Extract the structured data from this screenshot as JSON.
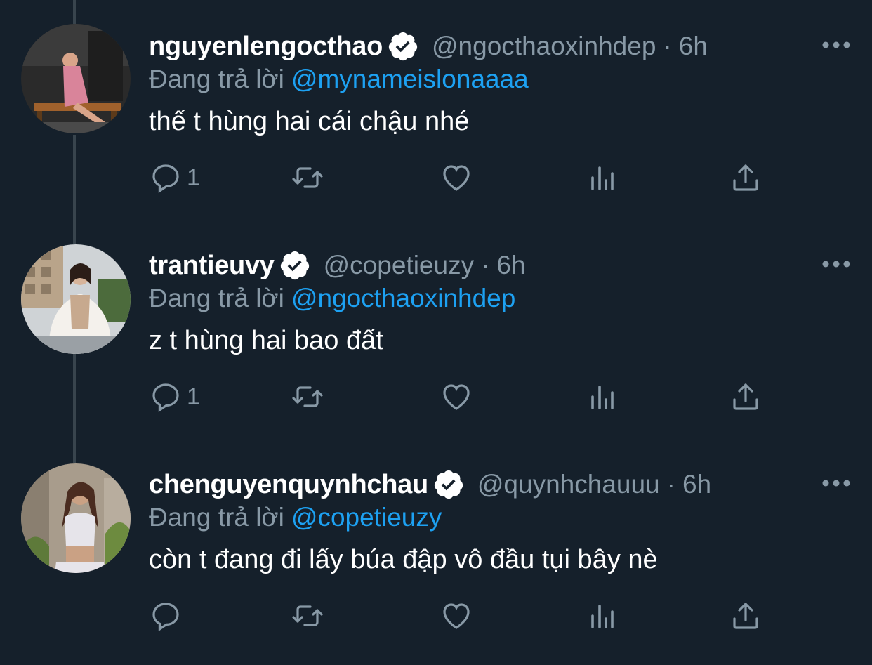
{
  "thread": {
    "tweets": [
      {
        "display_name": "nguyenlengocthao",
        "handle": "@ngocthaoxinhdep",
        "separator": "·",
        "time": "6h",
        "reply_prefix": "Đang trả lời",
        "reply_to": "@mynameislonaaaa",
        "text": "thế t hùng hai cái chậu nhé",
        "reply_count": "1",
        "verified": true
      },
      {
        "display_name": "trantieuvy",
        "handle": "@copetieuzy",
        "separator": "·",
        "time": "6h",
        "reply_prefix": "Đang trả lời",
        "reply_to": "@ngocthaoxinhdep",
        "text": "z t hùng hai bao đất",
        "reply_count": "1",
        "verified": true
      },
      {
        "display_name": "chenguyenquynhchau",
        "handle": "@quynhchauuu",
        "separator": "·",
        "time": "6h",
        "reply_prefix": "Đang trả lời",
        "reply_to": "@copetieuzy",
        "text": "còn t đang đi lấy búa đập vô đầu tụi bây nè",
        "reply_count": "",
        "verified": true
      }
    ]
  },
  "icons": {
    "verified": "verified-badge-icon",
    "more": "more-options-icon",
    "reply": "reply-icon",
    "retweet": "retweet-icon",
    "like": "heart-icon",
    "analytics": "analytics-icon",
    "share": "share-icon"
  },
  "colors": {
    "background": "#15202b",
    "primary_text": "#ffffff",
    "secondary_text": "#8899a6",
    "link": "#1da1f2",
    "thread_line": "#38444d"
  }
}
